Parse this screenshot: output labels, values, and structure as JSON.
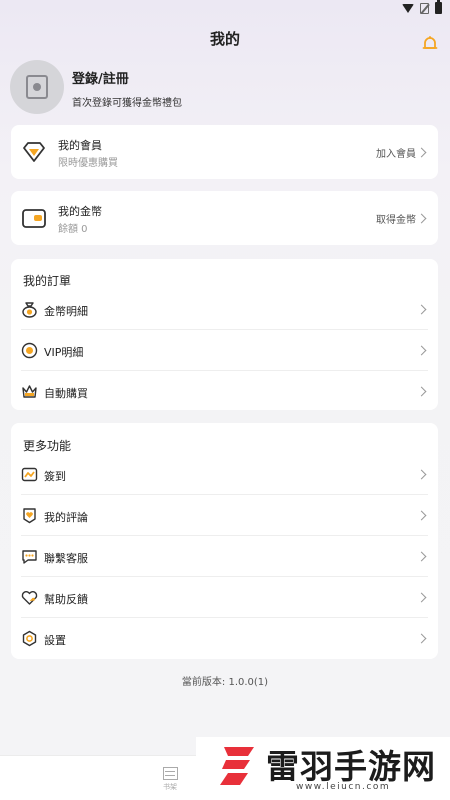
{
  "header": {
    "title": "我的"
  },
  "profile": {
    "title": "登錄/註冊",
    "subtitle": "首次登錄可獲得金幣禮包"
  },
  "membership": {
    "title": "我的會員",
    "subtitle": "限時優惠購買",
    "action": "加入會員"
  },
  "coins": {
    "title": "我的金幣",
    "subtitle": "餘額 0",
    "action": "取得金幣"
  },
  "orders": {
    "title": "我的訂單",
    "items": [
      {
        "label": "金幣明細",
        "icon": "coin-bag-icon"
      },
      {
        "label": "VIP明細",
        "icon": "vip-badge-icon"
      },
      {
        "label": "自動購買",
        "icon": "crown-icon"
      }
    ]
  },
  "more": {
    "title": "更多功能",
    "items": [
      {
        "label": "簽到",
        "icon": "checkin-calendar-icon"
      },
      {
        "label": "我的評論",
        "icon": "comment-heart-icon"
      },
      {
        "label": "聯繫客服",
        "icon": "chat-bubble-icon"
      },
      {
        "label": "幫助反饋",
        "icon": "heart-feedback-icon"
      },
      {
        "label": "設置",
        "icon": "gear-icon"
      }
    ]
  },
  "version": "當前版本: 1.0.0(1)",
  "bottom_nav": {
    "shelf_label": "书架"
  },
  "watermark": {
    "title": "雷羽手游网",
    "url": "www.leiucn.com"
  },
  "colors": {
    "accent": "#f5a623",
    "background": "#f4f4f6",
    "card": "#ffffff",
    "watermark_red": "#e8303a"
  }
}
